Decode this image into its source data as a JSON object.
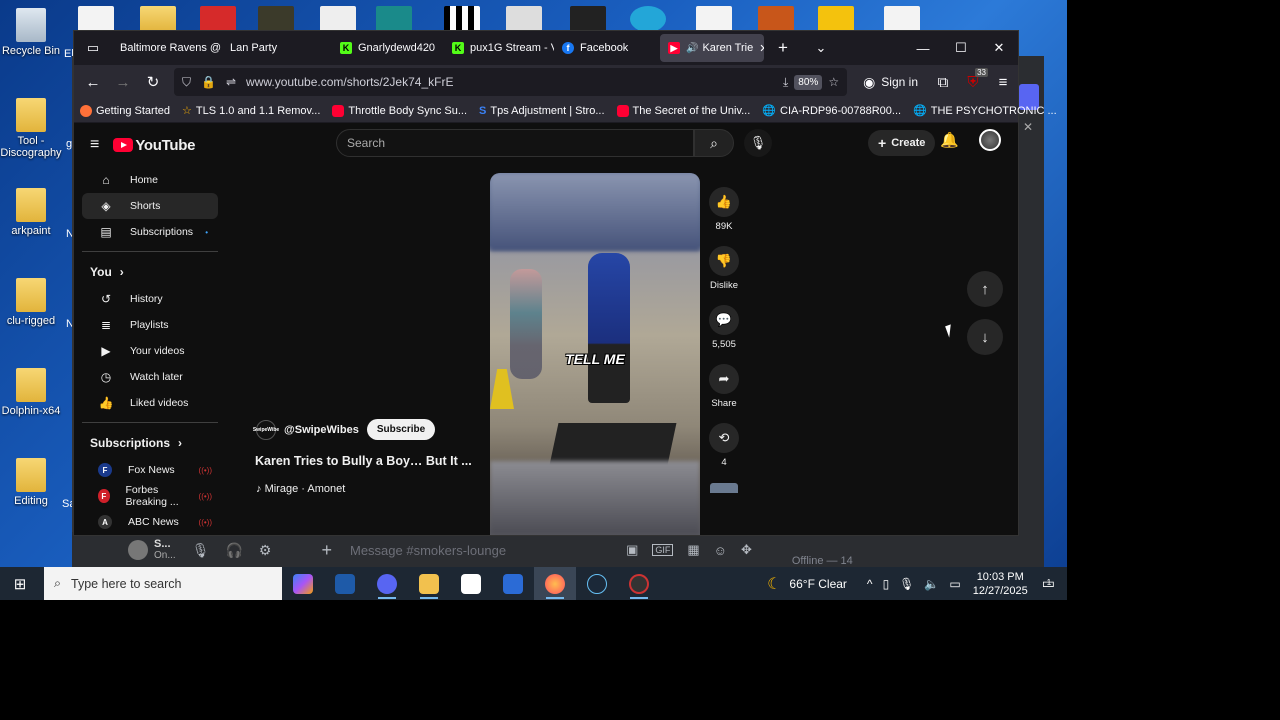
{
  "desktop": {
    "icons": [
      {
        "label": "Recycle Bin"
      },
      {
        "label": "Tool - Discography"
      },
      {
        "label": "arkpaint"
      },
      {
        "label": "clu-rigged"
      },
      {
        "label": "Dolphin-x64"
      },
      {
        "label": "Editing"
      }
    ],
    "partial_labels": {
      "el": "El",
      "g": "g",
      "n1": "N",
      "n2": "N",
      "sa": "Sa"
    }
  },
  "browser": {
    "tabs": [
      {
        "label": "Baltimore Ravens @",
        "color": "#2c2c7a"
      },
      {
        "label": "Lan Party",
        "color": "#444"
      },
      {
        "label": "Gnarlydewd420",
        "color": "#53fc18"
      },
      {
        "label": "pux1G Stream - V",
        "color": "#53fc18"
      },
      {
        "label": "Facebook",
        "color": "#1877f2"
      },
      {
        "label": "Karen Trie",
        "color": "#ff0033"
      }
    ],
    "url": "www.youtube.com/shorts/2Jek74_kFrE",
    "zoom": "80%",
    "sign_in": "Sign in",
    "ext_badge": "33",
    "bookmarks": [
      {
        "label": "Getting Started",
        "color": "#ff7139"
      },
      {
        "label": "TLS 1.0 and 1.1 Remov...",
        "color": "#ffb300"
      },
      {
        "label": "Throttle Body Sync Su...",
        "color": "#ff0033"
      },
      {
        "label": "Tps Adjustment | Stro...",
        "color": "#3b82f6"
      },
      {
        "label": "The Secret of the Univ...",
        "color": "#ff0033"
      },
      {
        "label": "CIA-RDP96-00788R00...",
        "color": "#bbbbbb"
      },
      {
        "label": "THE PSYCHOTRONIC ...",
        "color": "#bbbbbb"
      }
    ]
  },
  "youtube": {
    "logo": "YouTube",
    "search_placeholder": "Search",
    "create": "Create",
    "sidebar": {
      "main": [
        "Home",
        "Shorts",
        "Subscriptions"
      ],
      "you_heading": "You",
      "you_items": [
        "History",
        "Playlists",
        "Your videos",
        "Watch later",
        "Liked videos"
      ],
      "subs_heading": "Subscriptions",
      "subs": [
        {
          "label": "Fox News",
          "color": "#1a3a8c",
          "ic": "F"
        },
        {
          "label": "Forbes Breaking ...",
          "color": "#d0202a",
          "ic": "F"
        },
        {
          "label": "ABC News",
          "color": "#333",
          "ic": "A"
        }
      ]
    },
    "short": {
      "caption": "TELL ME",
      "channel": "@SwipeWibes",
      "channel_avatar": "SwipeWibe",
      "subscribe": "Subscribe",
      "title": "Karen Tries to Bully a Boy… But It ...",
      "music": "Mirage · Amonet"
    },
    "actions": {
      "likes": "89K",
      "dislike": "Dislike",
      "comments": "5,505",
      "share": "Share",
      "remix": "4"
    }
  },
  "discord": {
    "user": "S...",
    "user_status": "On...",
    "message_placeholder": "Message #smokers-lounge",
    "offline": "Offline — 14"
  },
  "taskbar": {
    "search_placeholder": "Type here to search",
    "weather": "66°F  Clear",
    "time": "10:03 PM",
    "date": "12/27/2025",
    "notif_count": "1"
  }
}
